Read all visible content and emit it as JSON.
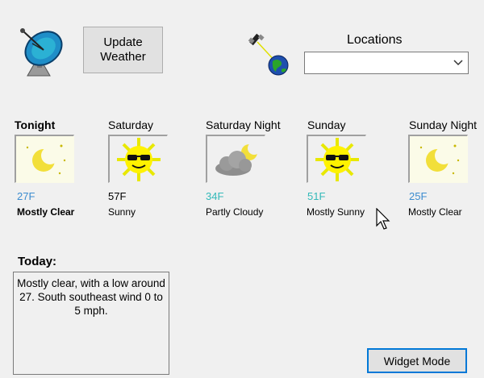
{
  "toolbar": {
    "update_label": "Update Weather"
  },
  "locations": {
    "label": "Locations",
    "selected": ""
  },
  "colors": {
    "cold_temp": "#3c8ccf",
    "cool_temp": "#33b9b9",
    "warm_temp": "#000000"
  },
  "periods": [
    {
      "name": "Tonight",
      "temp": "27F",
      "condition": "Mostly Clear",
      "icon": "moon-icon",
      "temp_color": "#3c8ccf"
    },
    {
      "name": "Saturday",
      "temp": "57F",
      "condition": "Sunny",
      "icon": "sun-sunglasses-icon",
      "temp_color": "#000000"
    },
    {
      "name": "Saturday Night",
      "temp": "34F",
      "condition": "Partly Cloudy",
      "icon": "cloud-moon-icon",
      "temp_color": "#33b9b9"
    },
    {
      "name": "Sunday",
      "temp": "51F",
      "condition": "Mostly Sunny",
      "icon": "sun-sunglasses-icon",
      "temp_color": "#33b9b9"
    },
    {
      "name": "Sunday Night",
      "temp": "25F",
      "condition": "Mostly Clear",
      "icon": "moon-icon",
      "temp_color": "#3c8ccf"
    }
  ],
  "today": {
    "label": "Today:",
    "text": "Mostly clear, with a low around 27. South southeast wind 0 to 5 mph."
  },
  "footer": {
    "widget_mode_label": "Widget Mode"
  }
}
